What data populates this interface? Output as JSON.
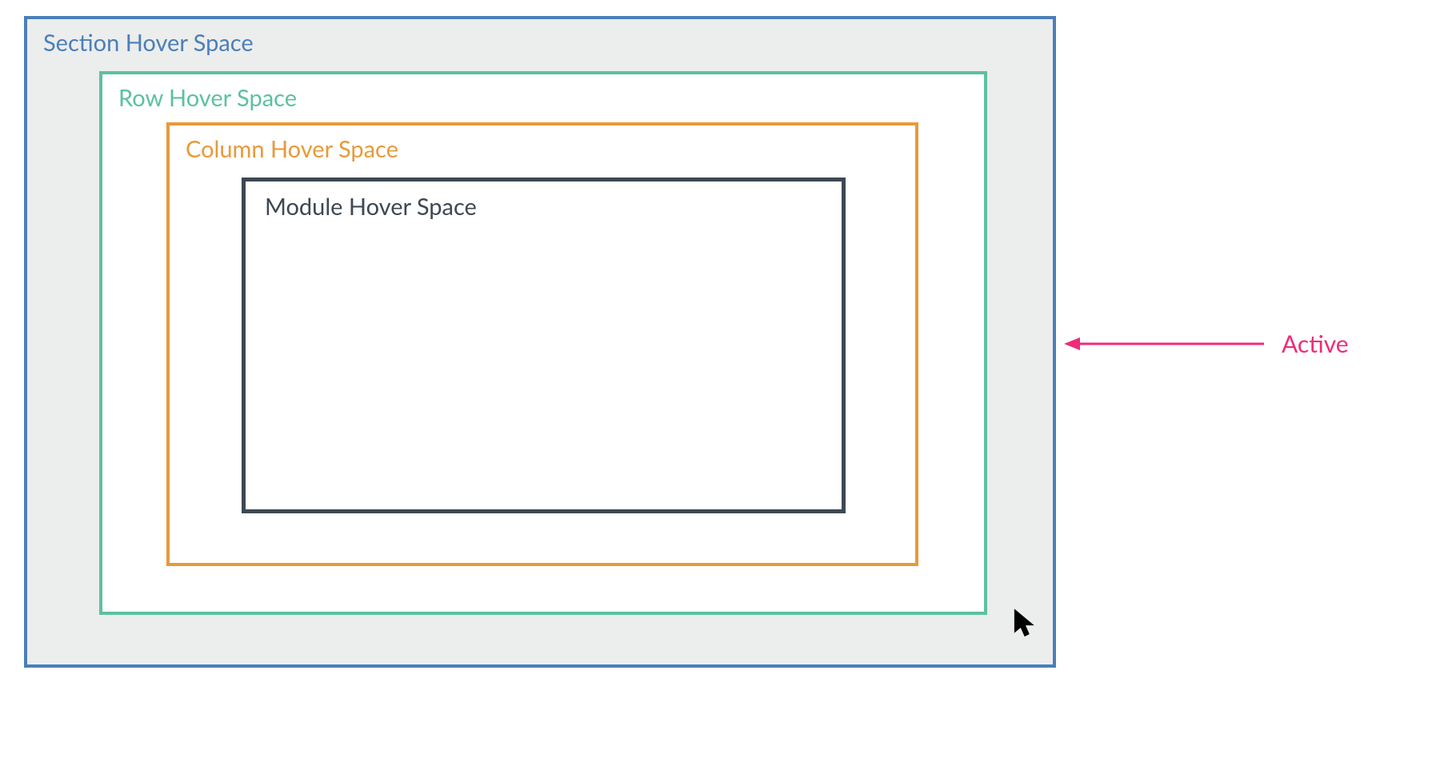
{
  "diagram": {
    "section": {
      "label": "Section Hover Space",
      "color": "#4a7fb8",
      "background": "#eceded"
    },
    "row": {
      "label": "Row Hover Space",
      "color": "#5cc1a0",
      "background": "#ffffff"
    },
    "column": {
      "label": "Column Hover Space",
      "color": "#e79a3a",
      "background": "#ffffff"
    },
    "module": {
      "label": "Module Hover Space",
      "color": "#3d4853",
      "background": "#ffffff"
    }
  },
  "annotation": {
    "label": "Active",
    "color": "#ee2c7a",
    "target": "section"
  },
  "cursor": {
    "color": "#000000"
  }
}
